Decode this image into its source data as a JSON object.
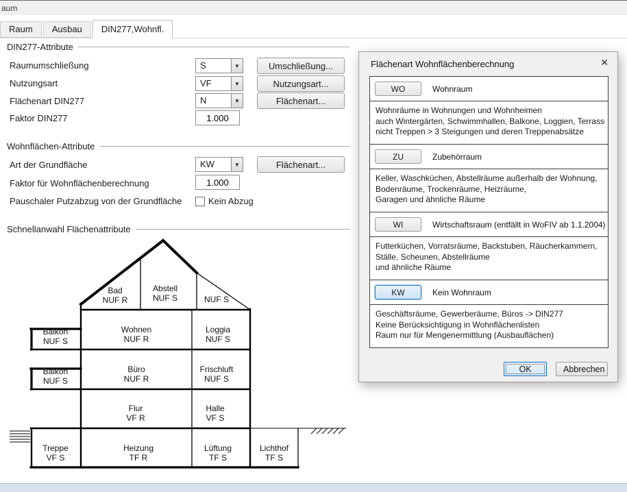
{
  "window": {
    "title_fragment": "aum",
    "tabs": [
      {
        "label": "Raum",
        "active": false
      },
      {
        "label": "Ausbau",
        "active": false
      },
      {
        "label": "DIN277,Wohnfl.",
        "active": true
      }
    ]
  },
  "icons": {
    "close": "✕",
    "dropdown_arrow": "▼"
  },
  "colors": {
    "selection_blue": "#2c7cc4",
    "chrome_gray": "#f0f0f0",
    "footer_blue": "#d9e3f0"
  },
  "din277": {
    "section_title": "DIN277-Attribute",
    "raumumschliessung": {
      "label": "Raumumschließung",
      "value": "S",
      "button": "Umschließung..."
    },
    "nutzungsart": {
      "label": "Nutzungsart",
      "value": "VF",
      "button": "Nutzungsart..."
    },
    "flaechenart": {
      "label": "Flächenart DIN277",
      "value": "N",
      "button": "Flächenart..."
    },
    "faktor": {
      "label": "Faktor DIN277",
      "value": "1.000"
    }
  },
  "wohnflaechen": {
    "section_title": "Wohnflächen-Attribute",
    "grundflaeche": {
      "label": "Art der Grundfläche",
      "value": "KW",
      "button": "Flächenart..."
    },
    "faktor": {
      "label": "Faktor für Wohnflächenberechnung",
      "value": "1.000"
    },
    "putzabzug": {
      "label": "Pauschaler Putzabzug von der Grundfläche",
      "checkbox_label": "Kein Abzug",
      "checked": false
    }
  },
  "schnellanwahl": {
    "section_title": "Schnellanwahl Flächenattribute",
    "rooms": [
      {
        "name": "Bad",
        "type": "NUF R"
      },
      {
        "name": "Abstell",
        "type": "NUF S"
      },
      {
        "name": "",
        "type": "NUF S"
      },
      {
        "name": "Balkon",
        "type": "NUF S"
      },
      {
        "name": "Wohnen",
        "type": "NUF R"
      },
      {
        "name": "Loggia",
        "type": "NUF S"
      },
      {
        "name": "Balkon",
        "type": "NUF S"
      },
      {
        "name": "Büro",
        "type": "NUF R"
      },
      {
        "name": "Frischluft",
        "type": "NUF S"
      },
      {
        "name": "Flur",
        "type": "VF R"
      },
      {
        "name": "Halle",
        "type": "VF S"
      },
      {
        "name": "Treppe",
        "type": "VF S"
      },
      {
        "name": "Heizung",
        "type": "TF R"
      },
      {
        "name": "Lüftung",
        "type": "TF S"
      },
      {
        "name": "Lichthof",
        "type": "TF S"
      }
    ]
  },
  "dialog": {
    "title": "Flächenart Wohnflächenberechnung",
    "entries": [
      {
        "code": "WO",
        "name": "Wohnraum",
        "selected": false,
        "desc_lines": [
          "Wohnräume in Wohnungen und Wohnheimen",
          "auch Wintergärten, Schwimmhallen, Balkone, Loggien, Terrassen",
          "nicht Treppen > 3 Steigungen und deren Treppenabsätze"
        ]
      },
      {
        "code": "ZU",
        "name": "Zubehörraum",
        "selected": false,
        "desc_lines": [
          "Keller, Waschküchen, Abstellräume außerhalb der Wohnung,",
          "Bodenräume, Trockenräume, Heizräume,",
          "Garagen und ähnliche Räume"
        ]
      },
      {
        "code": "WI",
        "name": "Wirtschaftsraum (entfällt in WoFIV ab 1.1.2004)",
        "selected": false,
        "desc_lines": [
          "Futterküchen, Vorratsräume, Backstuben, Räucherkammern,",
          "Ställe, Scheunen, Abstellräume",
          "und ähnliche Räume"
        ]
      },
      {
        "code": "KW",
        "name": "Kein Wohnraum",
        "selected": true,
        "desc_lines": [
          "Geschäftsräume, Gewerberäume, Büros -> DIN277",
          "Keine Berücksichtigung in Wohnflächenlisten",
          "Raum nur für Mengenermittlung (Ausbauflächen)"
        ]
      }
    ],
    "ok_label": "OK",
    "cancel_label": "Abbrechen"
  }
}
